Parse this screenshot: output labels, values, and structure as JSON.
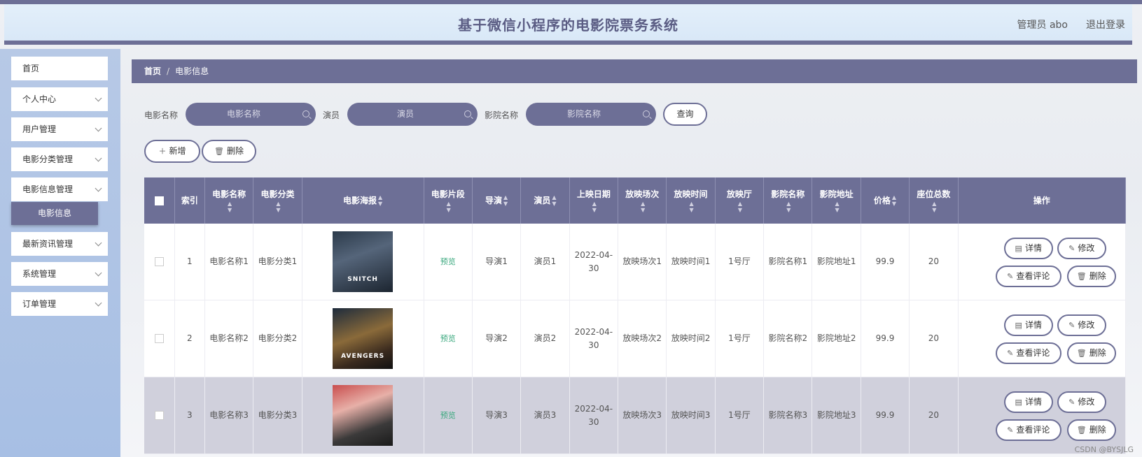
{
  "header": {
    "title": "基于微信小程序的电影院票务系统",
    "user": "管理员 abo",
    "logout": "退出登录"
  },
  "sidebar": {
    "items": [
      {
        "label": "首页",
        "has_chevron": false
      },
      {
        "label": "个人中心",
        "has_chevron": true
      },
      {
        "label": "用户管理",
        "has_chevron": true
      },
      {
        "label": "电影分类管理",
        "has_chevron": true
      },
      {
        "label": "电影信息管理",
        "has_chevron": true
      },
      {
        "label": "最新资讯管理",
        "has_chevron": true
      },
      {
        "label": "系统管理",
        "has_chevron": true
      },
      {
        "label": "订单管理",
        "has_chevron": true
      }
    ],
    "active_subitem": "电影信息"
  },
  "breadcrumb": {
    "home": "首页",
    "separator": "/",
    "current": "电影信息"
  },
  "search": {
    "movie_name_label": "电影名称",
    "movie_name_placeholder": "电影名称",
    "actor_label": "演员",
    "actor_placeholder": "演员",
    "cinema_label": "影院名称",
    "cinema_placeholder": "影院名称",
    "query_button": "查询"
  },
  "actions": {
    "add": "新增",
    "delete": "删除"
  },
  "table": {
    "headers": [
      "索引",
      "电影名称",
      "电影分类",
      "电影海报",
      "电影片段",
      "导演",
      "演员",
      "上映日期",
      "放映场次",
      "放映时间",
      "放映厅",
      "影院名称",
      "影院地址",
      "价格",
      "座位总数",
      "操作"
    ],
    "rows": [
      {
        "index": "1",
        "name": "电影名称1",
        "category": "电影分类1",
        "poster_caption": "SNITCH",
        "clip": "预览",
        "director": "导演1",
        "actor": "演员1",
        "release": "2022-04-30",
        "session": "放映场次1",
        "time": "放映时间1",
        "hall": "1号厅",
        "cinema": "影院名称1",
        "address": "影院地址1",
        "price": "99.9",
        "seats": "20",
        "highlight": false
      },
      {
        "index": "2",
        "name": "电影名称2",
        "category": "电影分类2",
        "poster_caption": "AVENGERS",
        "clip": "预览",
        "director": "导演2",
        "actor": "演员2",
        "release": "2022-04-30",
        "session": "放映场次2",
        "time": "放映时间2",
        "hall": "1号厅",
        "cinema": "影院名称2",
        "address": "影院地址2",
        "price": "99.9",
        "seats": "20",
        "highlight": false
      },
      {
        "index": "3",
        "name": "电影名称3",
        "category": "电影分类3",
        "poster_caption": "",
        "clip": "预览",
        "director": "导演3",
        "actor": "演员3",
        "release": "2022-04-30",
        "session": "放映场次3",
        "time": "放映时间3",
        "hall": "1号厅",
        "cinema": "影院名称3",
        "address": "影院地址3",
        "price": "99.9",
        "seats": "20",
        "highlight": true
      }
    ],
    "op_labels": {
      "detail": "详情",
      "edit": "修改",
      "comments": "查看评论",
      "delete": "删除"
    }
  },
  "watermark": "CSDN @BYSJLG",
  "colors": {
    "accent": "#6d6f96",
    "preview_link": "#3aa87e"
  }
}
